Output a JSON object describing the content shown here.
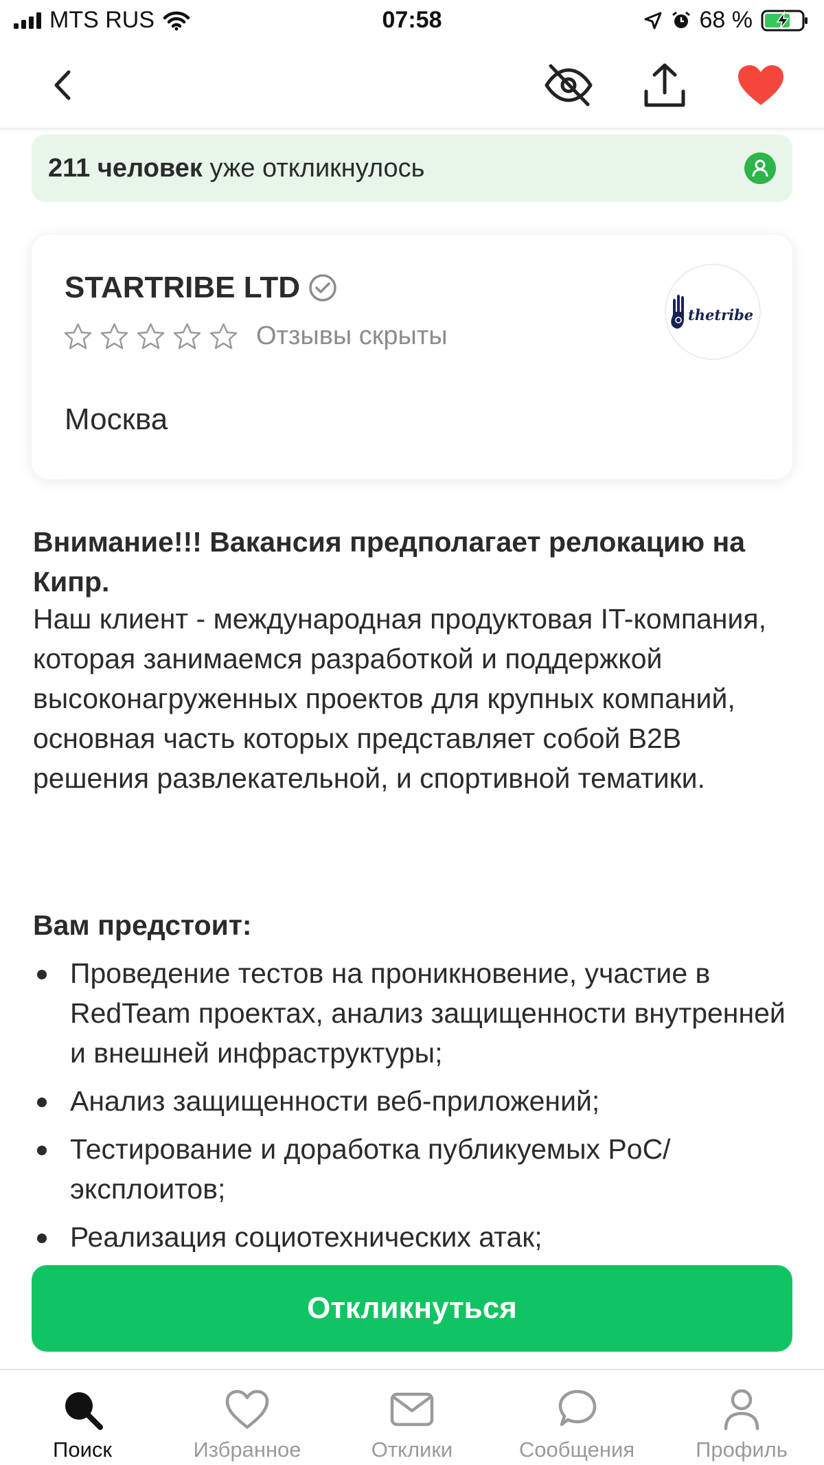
{
  "status_bar": {
    "carrier": "MTS RUS",
    "time": "07:58",
    "battery_percent": "68 %"
  },
  "header": {
    "back_icon": "chevron-left-icon",
    "hide_icon": "eye-off-icon",
    "share_icon": "share-icon",
    "favorite_icon": "heart-filled-icon",
    "favorite_color": "#f4473c"
  },
  "responses_banner": {
    "count_bold": "211 человек",
    "rest": " уже откликнулось",
    "icon": "person-icon",
    "bg_color": "#e8f6ea",
    "icon_color": "#2db44a"
  },
  "company": {
    "name": "STARTRIBE LTD",
    "verified_icon": "verified-check-icon",
    "rating": 0,
    "rating_max": 5,
    "reviews_text": "Отзывы скрыты",
    "city": "Москва",
    "logo_text": "thetribe"
  },
  "description": {
    "alert": "Внимание!!! Вакансия предполагает релокацию на Кипр.",
    "intro": "Наш клиент - международная продуктовая IT-компания, которая занимаемся разработкой и поддержкой высоконагруженных проектов для крупных компаний, основная часть которых представляет собой B2B решения развлекательной, и спортивной тематики.",
    "duties_title": "Вам предстоит:",
    "duties": [
      "Проведение тестов на проникновение, участие в RedTeam проектах, анализ защищенности внутренней и внешней инфраструктуры;",
      "Анализ защищенности веб-приложений;",
      "Тестирование и доработка публикуемых PoC/эксплоитов;",
      "Реализация социотехнических атак;"
    ]
  },
  "apply_button": {
    "label": "Откликнуться",
    "color": "#11c463"
  },
  "tab_bar": {
    "items": [
      {
        "label": "Поиск",
        "icon": "search-icon",
        "active": true
      },
      {
        "label": "Избранное",
        "icon": "heart-icon",
        "active": false
      },
      {
        "label": "Отклики",
        "icon": "mail-icon",
        "active": false
      },
      {
        "label": "Сообщения",
        "icon": "chat-bubble-icon",
        "active": false
      },
      {
        "label": "Профиль",
        "icon": "profile-icon",
        "active": false
      }
    ]
  }
}
